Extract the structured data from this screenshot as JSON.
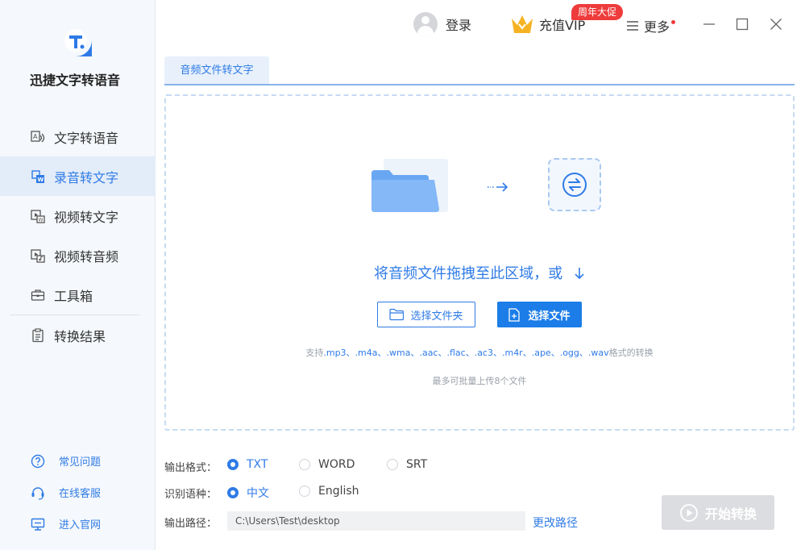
{
  "app": {
    "name": "迅捷文字转语音"
  },
  "sidebar": {
    "items": [
      {
        "label": "文字转语音",
        "icon": "text-to-speech-icon"
      },
      {
        "label": "录音转文字",
        "icon": "audio-to-text-icon",
        "active": true
      },
      {
        "label": "视频转文字",
        "icon": "video-to-text-icon"
      },
      {
        "label": "视频转音频",
        "icon": "video-to-audio-icon"
      },
      {
        "label": "工具箱",
        "icon": "toolbox-icon"
      },
      {
        "label": "转换结果",
        "icon": "results-icon"
      }
    ],
    "help": [
      {
        "label": "常见问题",
        "icon": "question-icon"
      },
      {
        "label": "在线客服",
        "icon": "headset-icon"
      },
      {
        "label": "进入官网",
        "icon": "monitor-icon"
      }
    ]
  },
  "topbar": {
    "login": "登录",
    "vip": "充值VIP",
    "promo": "周年大促",
    "more": "更多"
  },
  "tab": {
    "label": "音频文件转文字"
  },
  "dropzone": {
    "text": "将音频文件拖拽至此区域，或",
    "select_folder": "选择文件夹",
    "select_file": "选择文件",
    "support_prefix": "支持",
    "support_formats": ".mp3、.m4a、.wma、.aac、.flac、.ac3、.m4r、.ape、.ogg、.wav",
    "support_suffix": "格式的转换",
    "limit": "最多可批量上传8个文件"
  },
  "settings": {
    "format_label": "输出格式：",
    "formats": [
      "TXT",
      "WORD",
      "SRT"
    ],
    "format_selected": "TXT",
    "language_label": "识别语种：",
    "languages": [
      "中文",
      "English"
    ],
    "language_selected": "中文",
    "path_label": "输出路径：",
    "path_value": "C:\\Users\\Test\\desktop",
    "change_path": "更改路径"
  },
  "start_button": "开始转换",
  "colors": {
    "accent": "#2f7be6",
    "primary_button": "#1c7de8",
    "promo": "#ee3b3b",
    "disabled": "#dcdde0"
  }
}
